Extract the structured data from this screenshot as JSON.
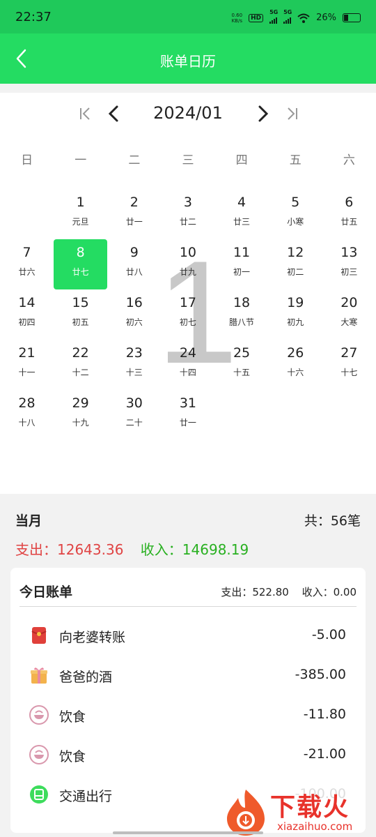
{
  "status": {
    "time": "22:37",
    "net_speed": "0.60",
    "net_unit": "KB/s",
    "hd": "HD",
    "sim1": "5G",
    "sim2": "5G",
    "battery": "26%"
  },
  "header": {
    "title": "账单日历"
  },
  "calendar": {
    "month_label": "2024/01",
    "watermark": "1",
    "weekdays": [
      "日",
      "一",
      "二",
      "三",
      "四",
      "五",
      "六"
    ],
    "days": [
      {
        "d": "1",
        "l": "元旦"
      },
      {
        "d": "2",
        "l": "廿一"
      },
      {
        "d": "3",
        "l": "廿二"
      },
      {
        "d": "4",
        "l": "廿三"
      },
      {
        "d": "5",
        "l": "小寒"
      },
      {
        "d": "6",
        "l": "廿五"
      },
      {
        "d": "7",
        "l": "廿六"
      },
      {
        "d": "8",
        "l": "廿七"
      },
      {
        "d": "9",
        "l": "廿八"
      },
      {
        "d": "10",
        "l": "廿九"
      },
      {
        "d": "11",
        "l": "初一"
      },
      {
        "d": "12",
        "l": "初二"
      },
      {
        "d": "13",
        "l": "初三"
      },
      {
        "d": "14",
        "l": "初四"
      },
      {
        "d": "15",
        "l": "初五"
      },
      {
        "d": "16",
        "l": "初六"
      },
      {
        "d": "17",
        "l": "初七"
      },
      {
        "d": "18",
        "l": "腊八节"
      },
      {
        "d": "19",
        "l": "初九"
      },
      {
        "d": "20",
        "l": "大寒"
      },
      {
        "d": "21",
        "l": "十一"
      },
      {
        "d": "22",
        "l": "十二"
      },
      {
        "d": "23",
        "l": "十三"
      },
      {
        "d": "24",
        "l": "十四"
      },
      {
        "d": "25",
        "l": "十五"
      },
      {
        "d": "26",
        "l": "十六"
      },
      {
        "d": "27",
        "l": "十七"
      },
      {
        "d": "28",
        "l": "十八"
      },
      {
        "d": "29",
        "l": "十九"
      },
      {
        "d": "30",
        "l": "二十"
      },
      {
        "d": "31",
        "l": "廿一"
      }
    ],
    "selected_day": "8"
  },
  "summary": {
    "month_label": "当月",
    "count": "共：56笔",
    "expense": "支出：12643.36",
    "income": "收入：14698.19"
  },
  "today": {
    "title": "今日账单",
    "expense": "支出：522.80",
    "income": "收入：0.00",
    "items": [
      {
        "name": "向老婆转账",
        "amount": "-5.00",
        "icon": "red-envelope-icon"
      },
      {
        "name": "爸爸的酒",
        "amount": "-385.00",
        "icon": "gift-icon"
      },
      {
        "name": "饮食",
        "amount": "-11.80",
        "icon": "food-bowl-icon"
      },
      {
        "name": "饮食",
        "amount": "-21.00",
        "icon": "food-bowl-icon"
      },
      {
        "name": "交通出行",
        "amount": "-100.00",
        "icon": "transport-icon"
      }
    ]
  },
  "watermark_logo": {
    "text": "下载火",
    "url_text": "xiazaihuo.com"
  },
  "colors": {
    "primary": "#24dc62",
    "expense": "#e04343",
    "income": "#28b020"
  }
}
